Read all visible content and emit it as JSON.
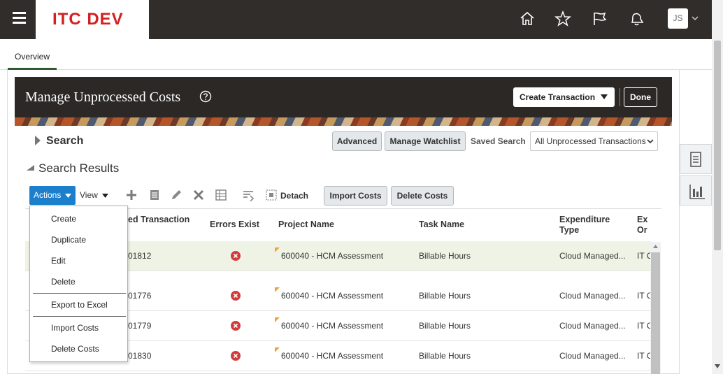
{
  "app": {
    "brand": "ITC DEV",
    "user_initials": "JS"
  },
  "tabs": {
    "overview": "Overview"
  },
  "header": {
    "title": "Manage Unprocessed Costs",
    "create_transaction": "Create Transaction",
    "done": "Done"
  },
  "search": {
    "label": "Search",
    "advanced": "Advanced",
    "manage_watchlist": "Manage Watchlist",
    "saved_search_label": "Saved Search",
    "saved_search_value": "All Unprocessed Transactions"
  },
  "results": {
    "label": "Search Results",
    "actions": "Actions",
    "view": "View",
    "detach": "Detach",
    "import_costs": "Import Costs",
    "delete_costs": "Delete Costs"
  },
  "columns": {
    "transaction": "ed Transaction",
    "errors_exist": "Errors Exist",
    "project_name": "Project Name",
    "task_name": "Task Name",
    "expenditure_type_1": "Expenditure",
    "expenditure_type_2": "Type",
    "exp_org_1": "Ex",
    "exp_org_2": "Or"
  },
  "rows": [
    {
      "transaction": "01812",
      "project": "600040 - HCM Assessment",
      "task": "Billable Hours",
      "expenditure": "Cloud Managed...",
      "org": "IT C"
    },
    {
      "transaction": "01776",
      "project": "600040 - HCM Assessment",
      "task": "Billable Hours",
      "expenditure": "Cloud Managed...",
      "org": "IT C"
    },
    {
      "transaction": "01779",
      "project": "600040 - HCM Assessment",
      "task": "Billable Hours",
      "expenditure": "Cloud Managed...",
      "org": "IT C"
    },
    {
      "transaction": "01830",
      "project": "600040 - HCM Assessment",
      "task": "Billable Hours",
      "expenditure": "Cloud Managed...",
      "org": "IT C"
    }
  ],
  "actions_menu": {
    "create": "Create",
    "duplicate": "Duplicate",
    "edit": "Edit",
    "delete": "Delete",
    "export_to_excel": "Export to Excel",
    "import_costs": "Import Costs",
    "delete_costs": "Delete Costs"
  },
  "colors": {
    "brand_red": "#d42020",
    "topbar": "#312d2a",
    "accent_blue": "#1b7fcc",
    "error_red": "#d23b3b"
  }
}
